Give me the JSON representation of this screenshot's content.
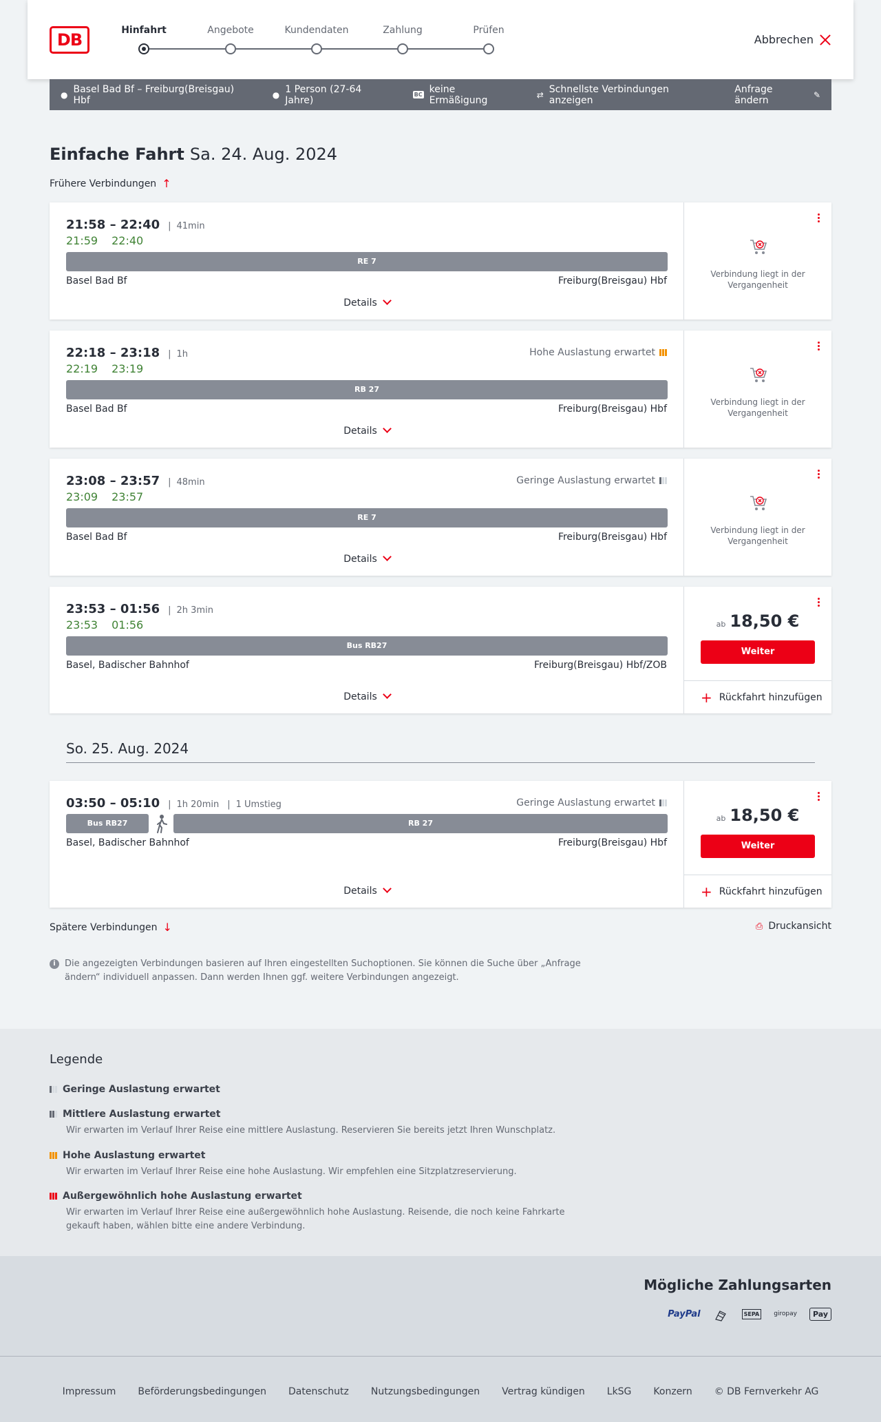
{
  "header": {
    "logo": "DB",
    "steps": [
      {
        "label": "Hinfahrt"
      },
      {
        "label": "Angebote"
      },
      {
        "label": "Kundendaten"
      },
      {
        "label": "Zahlung"
      },
      {
        "label": "Prüfen"
      }
    ],
    "cancel_label": "Abbrechen"
  },
  "search": {
    "route": "Basel Bad Bf – Freiburg(Breisgau) Hbf",
    "travellers": "1 Person (27-64 Jahre)",
    "bahncard_badge": "BC",
    "discount": "keine Ermäßigung",
    "option": "Schnellste Verbindungen anzeigen",
    "change_label": "Anfrage ändern"
  },
  "page": {
    "title": "Einfache Fahrt",
    "date": "Sa. 24. Aug. 2024",
    "earlier_label": "Frühere Verbindungen",
    "later_label": "Spätere Verbindungen",
    "print_label": "Druckansicht",
    "second_date": "So. 25. Aug. 2024",
    "info_text": "Die angezeigten Verbindungen basieren auf Ihren eingestellten Suchoptionen. Sie können die Suche über „Anfrage ändern“ individuell anpassen. Dann werden Ihnen ggf. weitere Verbindungen angezeigt."
  },
  "connections": [
    {
      "times": "21:58 – 22:40",
      "duration": "41min",
      "rt_dep": "21:59",
      "rt_arr": "22:40",
      "train": "RE 7",
      "from": "Basel Bad Bf",
      "to": "Freiburg(Breisgau) Hbf",
      "details": "Details",
      "status": "Verbindung liegt in der Vergangenheit"
    },
    {
      "times": "22:18 – 23:18",
      "duration": "1h",
      "rt_dep": "22:19",
      "rt_arr": "23:19",
      "utilization": "Hohe Auslastung erwartet",
      "train": "RB 27",
      "from": "Basel Bad Bf",
      "to": "Freiburg(Breisgau) Hbf",
      "details": "Details",
      "status": "Verbindung liegt in der Vergangenheit"
    },
    {
      "times": "23:08 – 23:57",
      "duration": "48min",
      "rt_dep": "23:09",
      "rt_arr": "23:57",
      "utilization": "Geringe Auslastung erwartet",
      "train": "RE 7",
      "from": "Basel Bad Bf",
      "to": "Freiburg(Breisgau) Hbf",
      "details": "Details",
      "status": "Verbindung liegt in der Vergangenheit"
    },
    {
      "times": "23:53 – 01:56",
      "duration": "2h 3min",
      "rt_dep": "23:53",
      "rt_arr": "01:56",
      "train": "Bus RB27",
      "from": "Basel, Badischer Bahnhof",
      "to": "Freiburg(Breisgau) Hbf/ZOB",
      "details": "Details",
      "price_prefix": "ab",
      "price": "18,50 €",
      "button": "Weiter",
      "return_label": "Rückfahrt hinzufügen"
    },
    {
      "times": "03:50 – 05:10",
      "duration": "1h 20min",
      "changes": "1 Umstieg",
      "utilization": "Geringe Auslastung erwartet",
      "train1": "Bus RB27",
      "train2": "RB 27",
      "from": "Basel, Badischer Bahnhof",
      "to": "Freiburg(Breisgau) Hbf",
      "details": "Details",
      "price_prefix": "ab",
      "price": "18,50 €",
      "button": "Weiter",
      "return_label": "Rückfahrt hinzufügen"
    }
  ],
  "legend": {
    "title": "Legende",
    "items": [
      {
        "title": "Geringe Auslastung erwartet",
        "desc": ""
      },
      {
        "title": "Mittlere Auslastung erwartet",
        "desc": "Wir erwarten im Verlauf Ihrer Reise eine mittlere Auslastung. Reservieren Sie bereits jetzt Ihren Wunschplatz."
      },
      {
        "title": "Hohe Auslastung erwartet",
        "desc": "Wir erwarten im Verlauf Ihrer Reise eine hohe Auslastung. Wir empfehlen eine Sitzplatzreservierung."
      },
      {
        "title": "Außergewöhnlich hohe Auslastung erwartet",
        "desc": "Wir erwarten im Verlauf Ihrer Reise eine außergewöhnlich hohe Auslastung. Reisende, die noch keine Fahrkarte gekauft haben, wählen bitte eine andere Verbindung."
      }
    ]
  },
  "payment": {
    "title": "Mögliche Zahlungsarten",
    "methods": [
      "PayPal",
      "SEPA",
      "giropay",
      "Pay"
    ]
  },
  "footer": {
    "links": [
      "Impressum",
      "Beförderungsbedingungen",
      "Datenschutz",
      "Nutzungsbedingungen",
      "Vertrag kündigen",
      "LkSG",
      "Konzern",
      "© DB Fernverkehr AG"
    ]
  },
  "colors": {
    "accent": "#ec0016",
    "realtime": "#408335",
    "bar": "#878c96",
    "high_util": "#f39200"
  }
}
